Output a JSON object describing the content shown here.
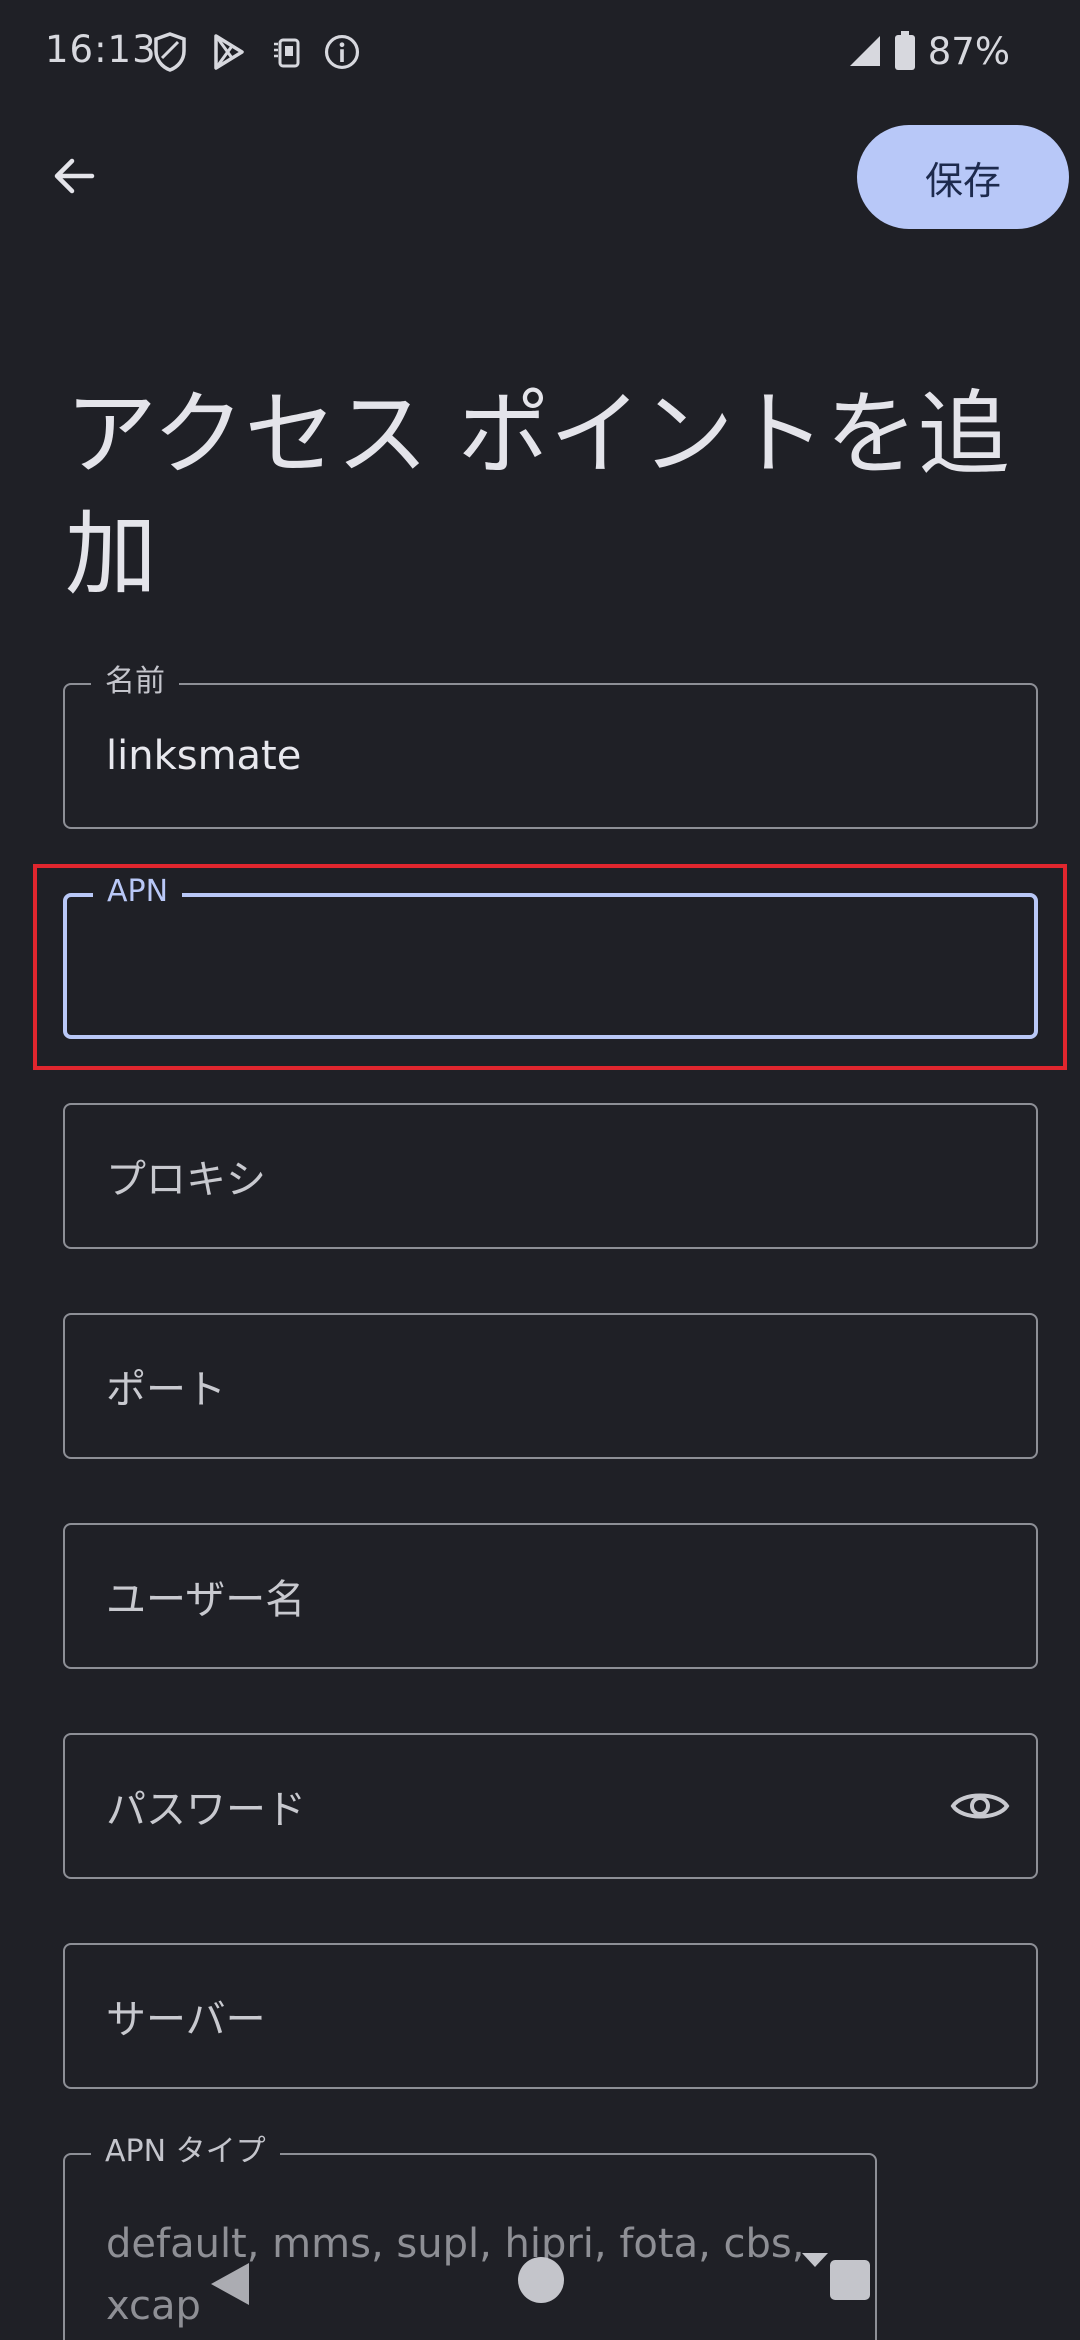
{
  "status_bar": {
    "time": "16:13",
    "left_icons": [
      "shield-icon",
      "play-store-icon",
      "sim-icon",
      "info-icon"
    ],
    "right_icons": [
      "signal-icon",
      "battery-icon"
    ],
    "battery": "87%"
  },
  "app_bar": {
    "back_icon": "arrow-back-icon",
    "save_label": "保存"
  },
  "page": {
    "title": "アクセス ポイントを追加"
  },
  "fields": {
    "name": {
      "label": "名前",
      "value": "linksmate"
    },
    "apn": {
      "label": "APN",
      "value": ""
    },
    "proxy": {
      "placeholder": "プロキシ"
    },
    "port": {
      "placeholder": "ポート"
    },
    "username": {
      "placeholder": "ユーザー名"
    },
    "password": {
      "placeholder": "パスワード",
      "toggle_icon": "eye-icon"
    },
    "server": {
      "placeholder": "サーバー"
    },
    "apn_type": {
      "label": "APN タイプ",
      "placeholder": "default, mms, supl, hipri, fota, cbs, xcap"
    }
  },
  "nav_bar": {
    "icons": [
      "nav-back-icon",
      "nav-home-icon",
      "nav-recents-icon"
    ]
  },
  "colors": {
    "background": "#1f2026",
    "accent": "#b8c8f8",
    "outline": "#8d8f96",
    "highlight": "#e0262e"
  }
}
